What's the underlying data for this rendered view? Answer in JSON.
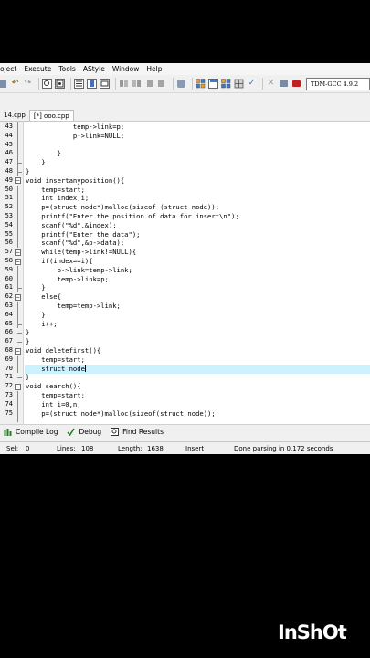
{
  "menu": [
    "oject",
    "Execute",
    "Tools",
    "AStyle",
    "Window",
    "Help"
  ],
  "toolbar": {
    "compiler": "TDM-GCC 4.9.2"
  },
  "tabs": [
    {
      "label": "14.cpp",
      "active": false
    },
    {
      "label": "[*] ooo.cpp",
      "active": true
    }
  ],
  "editor": {
    "lines": [
      {
        "num": "43",
        "text": "            temp->link=p;"
      },
      {
        "num": "44",
        "text": "            p->link=NULL;"
      },
      {
        "num": "45",
        "text": ""
      },
      {
        "num": "46",
        "text": "        }"
      },
      {
        "num": "47",
        "text": "    }"
      },
      {
        "num": "48",
        "text": "}"
      },
      {
        "num": "49",
        "text": "void insertanyposition(){"
      },
      {
        "num": "50",
        "text": "    temp=start;"
      },
      {
        "num": "51",
        "text": "    int index,i;"
      },
      {
        "num": "52",
        "text": "    p=(struct node*)malloc(sizeof (struct node));"
      },
      {
        "num": "53",
        "text": "    printf(\"Enter the position of data for insert\\n\");"
      },
      {
        "num": "54",
        "text": "    scanf(\"%d\",&index);"
      },
      {
        "num": "55",
        "text": "    printf(\"Enter the data\");"
      },
      {
        "num": "56",
        "text": "    scanf(\"%d\",&p->data);"
      },
      {
        "num": "57",
        "text": "    while(temp->link!=NULL){"
      },
      {
        "num": "58",
        "text": "    if(index==i){"
      },
      {
        "num": "59",
        "text": "        p->link=temp->link;"
      },
      {
        "num": "60",
        "text": "        temp->link=p;"
      },
      {
        "num": "61",
        "text": "    }"
      },
      {
        "num": "62",
        "text": "    else{"
      },
      {
        "num": "63",
        "text": "        temp=temp->link;"
      },
      {
        "num": "64",
        "text": "    }"
      },
      {
        "num": "65",
        "text": "    i++;"
      },
      {
        "num": "66",
        "text": "}"
      },
      {
        "num": "67",
        "text": "}"
      },
      {
        "num": "68",
        "text": "void deletefirst(){"
      },
      {
        "num": "69",
        "text": "    temp=start;"
      },
      {
        "num": "70",
        "text": "    struct node"
      },
      {
        "num": "71",
        "text": "}"
      },
      {
        "num": "72",
        "text": "void search(){"
      },
      {
        "num": "73",
        "text": "    temp=start;"
      },
      {
        "num": "74",
        "text": "    int i=0,n;"
      },
      {
        "num": "75",
        "text": "    p=(struct node*)malloc(sizeof(struct node));"
      }
    ]
  },
  "panels": {
    "compile_log": "Compile Log",
    "debug": "Debug",
    "find_results": "Find Results"
  },
  "status": {
    "sel_label": "Sel:",
    "sel_value": "0",
    "lines_label": "Lines:",
    "lines_value": "108",
    "length_label": "Length:",
    "length_value": "1638",
    "mode": "Insert",
    "message": "Done parsing in 0.172 seconds"
  },
  "watermark": "InShOt"
}
